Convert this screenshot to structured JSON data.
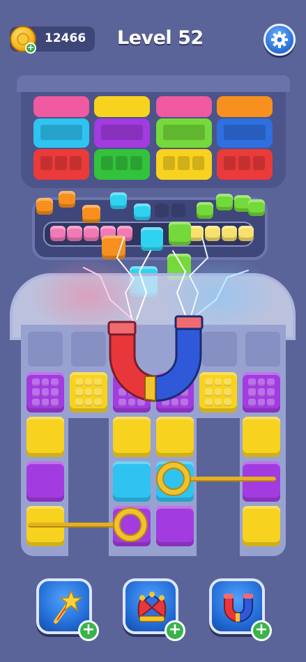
{
  "hud": {
    "coins": "12466",
    "level": "Level 52",
    "settings_icon": "gear-icon",
    "coin_icon": "coin-icon"
  },
  "colors": {
    "background": "#5b6499",
    "pink": "#ef5aa0",
    "cyan": "#2fc3f2",
    "red": "#ea3a3a",
    "purple": "#a23be0",
    "green": "#33c23b",
    "yellow": "#f7d21e",
    "lime": "#74d93a",
    "orange": "#f7901e",
    "blue": "#2f6fe0"
  },
  "bins": [
    {
      "top": "pink",
      "middle": "cyan",
      "bottom": "red"
    },
    {
      "top": "yellow",
      "middle": "purple",
      "bottom": "green"
    },
    {
      "top": "pink",
      "middle": "lime",
      "bottom": "yellow"
    },
    {
      "top": "orange",
      "middle": "blue",
      "bottom": "red"
    }
  ],
  "boosters": [
    {
      "name": "magic-wand",
      "icon": "star-wand-icon"
    },
    {
      "name": "jester-hat",
      "icon": "jester-hat-icon"
    },
    {
      "name": "magnet",
      "icon": "magnet-icon"
    }
  ]
}
